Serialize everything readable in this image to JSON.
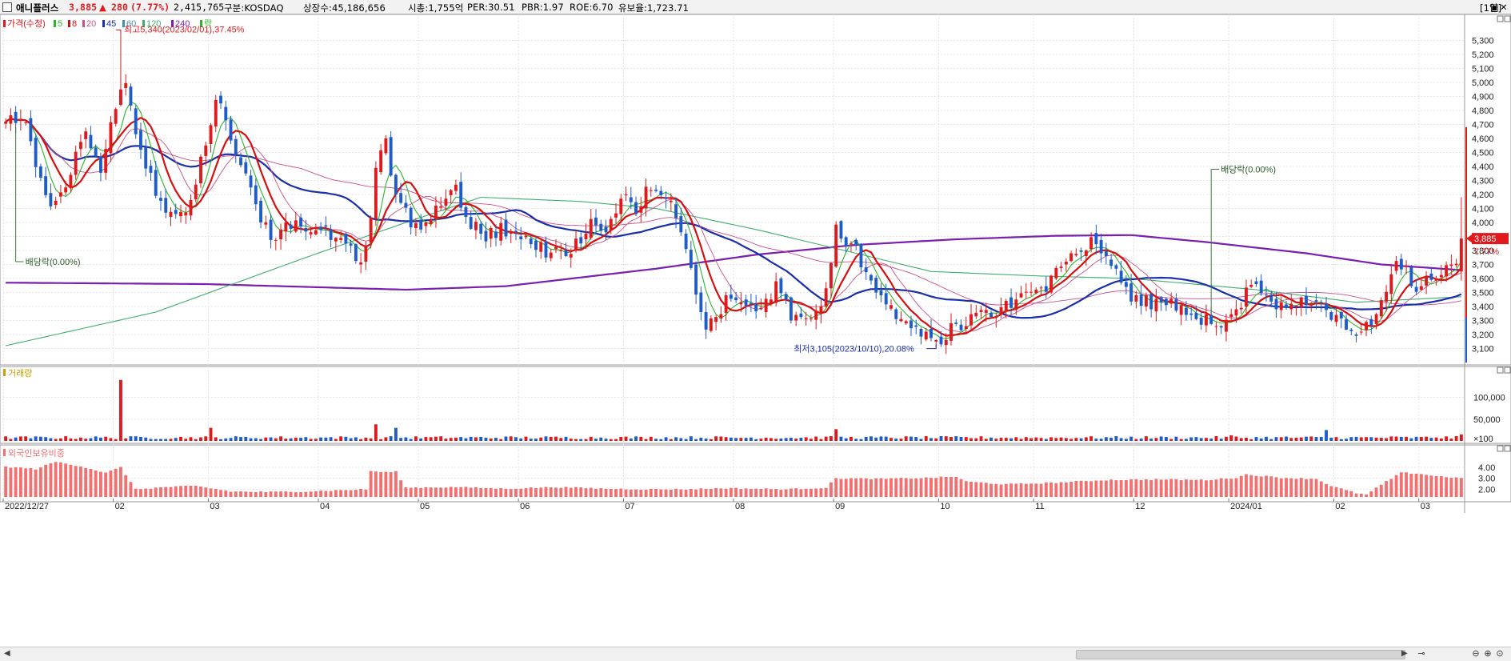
{
  "header": {
    "checkbox": "",
    "name": "애니플러스",
    "price": "3,885",
    "arrow": "▲",
    "change": "280",
    "change_pct": "(7.77%)",
    "volume": "2,415,765",
    "market": "구분:KOSDAQ",
    "shares": "상장수:45,186,656",
    "mktcap": "시총:1,755억",
    "per": "PER:30.51",
    "pbr": "PBR:1.97",
    "roe": "ROE:6.70",
    "float": "유보율:1,723.71",
    "period": "[1일]",
    "buttons": [
      "▣",
      "✕"
    ]
  },
  "colors": {
    "up": "#e0191d",
    "down": "#1f5cc8",
    "ma5": "#2db52d",
    "ma8": "#d41010",
    "ma20": "#c8508c",
    "ma45": "#1a2fa8",
    "ma60": "#3e8fb4",
    "ma120": "#3fae6e",
    "ma240": "#7a1fb0",
    "foreign": "#f27070",
    "grid": "#e4e4e4"
  },
  "chart_data": [
    {
      "type": "candlestick",
      "title": "가격(수정)",
      "legend": [
        {
          "label": "가격(수정)",
          "color": "#e0191d"
        },
        {
          "label": "5",
          "color": "#2db52d"
        },
        {
          "label": "8",
          "color": "#d41010"
        },
        {
          "label": "20",
          "color": "#c8508c"
        },
        {
          "label": "45",
          "color": "#1a2fa8"
        },
        {
          "label": "60",
          "color": "#3e8fb4"
        },
        {
          "label": "120",
          "color": "#3fae6e"
        },
        {
          "label": "240",
          "color": "#7a1fb0"
        },
        {
          "label": "락",
          "color": "#2db52d"
        }
      ],
      "ylim": [
        3000,
        5440
      ],
      "yticks": [
        "5,300",
        "5,200",
        "5,100",
        "5,000",
        "4,900",
        "4,800",
        "4,700",
        "4,600",
        "4,500",
        "4,400",
        "4,300",
        "4,200",
        "4,100",
        "4,000",
        "3,900",
        "3,800",
        "3,700",
        "3,600",
        "3,500",
        "3,400",
        "3,300",
        "3,200",
        "3,100"
      ],
      "ytick_values": [
        5300,
        5200,
        5100,
        5000,
        4900,
        4800,
        4700,
        4600,
        4500,
        4400,
        4300,
        4200,
        4100,
        4000,
        3900,
        3800,
        3700,
        3600,
        3500,
        3400,
        3300,
        3200,
        3100
      ],
      "x_labels": [
        "2022/12/27",
        "02",
        "03",
        "04",
        "05",
        "06",
        "07",
        "08",
        "09",
        "10",
        "11",
        "12",
        "2024/01",
        "02",
        "03"
      ],
      "x_label_index": [
        0,
        22,
        41,
        63,
        83,
        103,
        124,
        146,
        166,
        187,
        206,
        226,
        245,
        266,
        283
      ],
      "anchors": [
        [
          0,
          4700
        ],
        [
          3,
          4780
        ],
        [
          6,
          4450
        ],
        [
          9,
          4100
        ],
        [
          12,
          4300
        ],
        [
          16,
          4600
        ],
        [
          19,
          4350
        ],
        [
          22,
          4820
        ],
        [
          24,
          5000
        ],
        [
          26,
          4600
        ],
        [
          29,
          4300
        ],
        [
          33,
          4050
        ],
        [
          37,
          4150
        ],
        [
          40,
          4550
        ],
        [
          42,
          4900
        ],
        [
          44,
          4700
        ],
        [
          47,
          4400
        ],
        [
          50,
          4100
        ],
        [
          53,
          3900
        ],
        [
          56,
          3950
        ],
        [
          59,
          4000
        ],
        [
          62,
          3950
        ],
        [
          65,
          3900
        ],
        [
          68,
          3820
        ],
        [
          71,
          3760
        ],
        [
          73,
          3980
        ],
        [
          74,
          4400
        ],
        [
          76,
          4550
        ],
        [
          78,
          4200
        ],
        [
          81,
          4000
        ],
        [
          84,
          4000
        ],
        [
          87,
          4150
        ],
        [
          90,
          4220
        ],
        [
          93,
          4000
        ],
        [
          96,
          3900
        ],
        [
          99,
          3950
        ],
        [
          102,
          3900
        ],
        [
          105,
          3850
        ],
        [
          108,
          3800
        ],
        [
          111,
          3780
        ],
        [
          114,
          3850
        ],
        [
          117,
          4000
        ],
        [
          120,
          3900
        ],
        [
          123,
          4200
        ],
        [
          126,
          4100
        ],
        [
          129,
          4250
        ],
        [
          131,
          4200
        ],
        [
          133,
          4100
        ],
        [
          136,
          3800
        ],
        [
          138,
          3500
        ],
        [
          140,
          3250
        ],
        [
          142,
          3350
        ],
        [
          145,
          3500
        ],
        [
          148,
          3450
        ],
        [
          151,
          3400
        ],
        [
          154,
          3550
        ],
        [
          157,
          3350
        ],
        [
          160,
          3300
        ],
        [
          163,
          3400
        ],
        [
          165,
          3700
        ],
        [
          166,
          3950
        ],
        [
          168,
          3850
        ],
        [
          170,
          3800
        ],
        [
          172,
          3650
        ],
        [
          175,
          3500
        ],
        [
          178,
          3350
        ],
        [
          182,
          3250
        ],
        [
          185,
          3180
        ],
        [
          187,
          3180
        ],
        [
          190,
          3250
        ],
        [
          193,
          3300
        ],
        [
          196,
          3350
        ],
        [
          199,
          3400
        ],
        [
          202,
          3450
        ],
        [
          205,
          3480
        ],
        [
          208,
          3500
        ],
        [
          210,
          3650
        ],
        [
          213,
          3750
        ],
        [
          215,
          3800
        ],
        [
          217,
          3850
        ],
        [
          219,
          3750
        ],
        [
          221,
          3700
        ],
        [
          223,
          3600
        ],
        [
          225,
          3450
        ],
        [
          228,
          3430
        ],
        [
          231,
          3450
        ],
        [
          234,
          3400
        ],
        [
          237,
          3350
        ],
        [
          240,
          3300
        ],
        [
          243,
          3280
        ],
        [
          246,
          3350
        ],
        [
          248,
          3500
        ],
        [
          250,
          3550
        ],
        [
          253,
          3450
        ],
        [
          256,
          3400
        ],
        [
          259,
          3450
        ],
        [
          262,
          3480
        ],
        [
          265,
          3350
        ],
        [
          268,
          3250
        ],
        [
          271,
          3220
        ],
        [
          274,
          3350
        ],
        [
          276,
          3500
        ],
        [
          278,
          3700
        ],
        [
          280,
          3650
        ],
        [
          282,
          3500
        ],
        [
          285,
          3600
        ],
        [
          288,
          3650
        ],
        [
          290,
          3700
        ],
        [
          291,
          3885
        ]
      ],
      "extra_marks": [
        {
          "index": 23,
          "high": 5340
        },
        {
          "index": 186,
          "low": 3105
        }
      ],
      "annotations": {
        "high": "최고5,340(2023/02/01),37.45%",
        "low": "최저3,105(2023/10/10),20.08%",
        "div1": "배당락(0.00%)",
        "div2": "배당락(0.00%)",
        "last_price": "3,885",
        "last_pct": "7.77%"
      },
      "ma240_anchors": [
        [
          0,
          3570
        ],
        [
          40,
          3560
        ],
        [
          80,
          3520
        ],
        [
          100,
          3545
        ],
        [
          130,
          3670
        ],
        [
          150,
          3770
        ],
        [
          170,
          3840
        ],
        [
          190,
          3880
        ],
        [
          210,
          3905
        ],
        [
          225,
          3910
        ],
        [
          240,
          3860
        ],
        [
          260,
          3780
        ],
        [
          275,
          3700
        ],
        [
          291,
          3660
        ]
      ],
      "ma120_anchors": [
        [
          0,
          3120
        ],
        [
          30,
          3360
        ],
        [
          60,
          3750
        ],
        [
          80,
          4000
        ],
        [
          95,
          4180
        ],
        [
          115,
          4150
        ],
        [
          130,
          4100
        ],
        [
          150,
          3950
        ],
        [
          170,
          3780
        ],
        [
          185,
          3650
        ],
        [
          205,
          3620
        ],
        [
          225,
          3600
        ],
        [
          250,
          3520
        ],
        [
          270,
          3430
        ],
        [
          291,
          3470
        ]
      ]
    },
    {
      "type": "bar",
      "title": "거래량",
      "yticks": [
        "100,000",
        "50,000",
        "×100"
      ],
      "ytick_values": [
        100000,
        50000,
        0
      ],
      "ylim": [
        0,
        145000
      ],
      "spikes": [
        [
          23,
          140000
        ],
        [
          41,
          30000
        ],
        [
          74,
          38000
        ],
        [
          78,
          30000
        ],
        [
          166,
          27000
        ],
        [
          245,
          13000
        ],
        [
          264,
          25000
        ],
        [
          278,
          10000
        ],
        [
          286,
          8000
        ],
        [
          291,
          15000
        ]
      ]
    },
    {
      "type": "bar",
      "title": "외국인보유비중",
      "yticks": [
        "4.00",
        "3.00",
        "2.00"
      ],
      "ytick_values": [
        4.0,
        3.0,
        2.0
      ],
      "ylim": [
        1.3,
        4.8
      ],
      "anchors": [
        [
          0,
          4.05
        ],
        [
          6,
          3.85
        ],
        [
          10,
          4.5
        ],
        [
          15,
          4.1
        ],
        [
          20,
          3.5
        ],
        [
          23,
          4.0
        ],
        [
          26,
          2.0
        ],
        [
          32,
          2.2
        ],
        [
          38,
          2.3
        ],
        [
          45,
          1.8
        ],
        [
          52,
          1.75
        ],
        [
          60,
          1.8
        ],
        [
          66,
          1.9
        ],
        [
          72,
          2.0
        ],
        [
          73,
          3.65
        ],
        [
          76,
          3.55
        ],
        [
          78,
          3.6
        ],
        [
          80,
          2.15
        ],
        [
          90,
          2.2
        ],
        [
          100,
          2.05
        ],
        [
          110,
          2.2
        ],
        [
          120,
          2.05
        ],
        [
          128,
          2.0
        ],
        [
          136,
          2.0
        ],
        [
          144,
          2.1
        ],
        [
          156,
          2.0
        ],
        [
          164,
          2.15
        ],
        [
          166,
          3.0
        ],
        [
          175,
          2.95
        ],
        [
          185,
          3.05
        ],
        [
          190,
          3.15
        ],
        [
          192,
          2.7
        ],
        [
          200,
          2.45
        ],
        [
          210,
          2.6
        ],
        [
          220,
          2.85
        ],
        [
          230,
          2.9
        ],
        [
          240,
          2.85
        ],
        [
          246,
          3.05
        ],
        [
          248,
          3.35
        ],
        [
          255,
          3.05
        ],
        [
          262,
          2.95
        ],
        [
          265,
          2.3
        ],
        [
          270,
          1.65
        ],
        [
          272,
          1.5
        ],
        [
          276,
          2.7
        ],
        [
          279,
          3.5
        ],
        [
          282,
          3.45
        ],
        [
          286,
          3.2
        ],
        [
          290,
          3.05
        ]
      ]
    }
  ]
}
